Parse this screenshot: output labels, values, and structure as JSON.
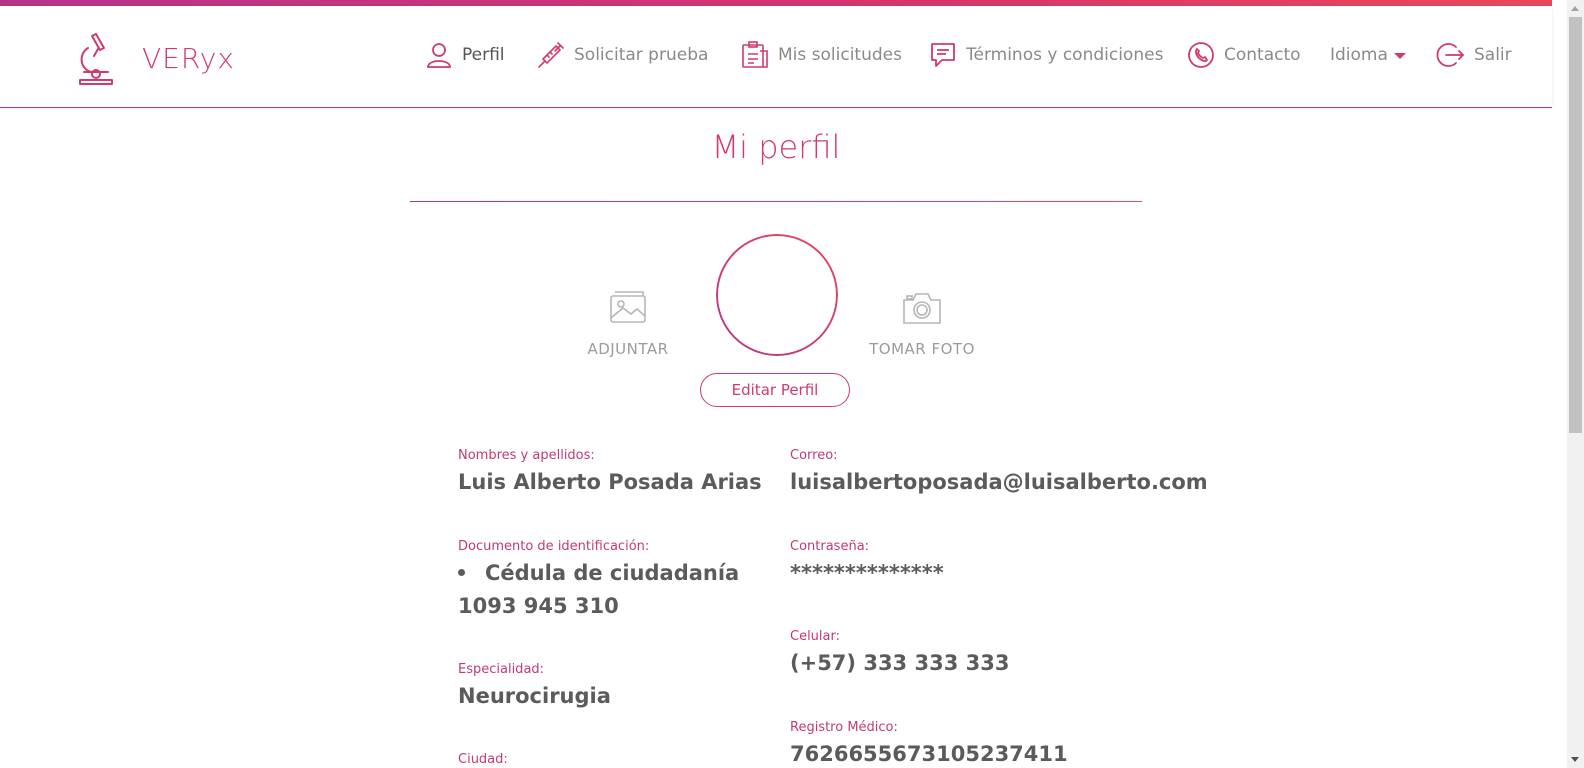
{
  "brand": {
    "name": "VERyx",
    "accent": "#d13a6a",
    "accent_gradient_start": "#b5348a",
    "accent_gradient_end": "#e8485b"
  },
  "nav": {
    "items": [
      {
        "label": "Perfil",
        "icon": "user-icon",
        "active": true
      },
      {
        "label": "Solicitar prueba",
        "icon": "syringe-icon"
      },
      {
        "label": "Mis solicitudes",
        "icon": "clipboard-icon"
      },
      {
        "label": "Términos y condiciones",
        "icon": "message-icon"
      },
      {
        "label": "Contacto",
        "icon": "phone-icon"
      },
      {
        "label": "Idioma",
        "icon": "caret-down-icon"
      },
      {
        "label": "Salir",
        "icon": "logout-icon"
      }
    ]
  },
  "profile": {
    "title": "Mi perfil",
    "attach_label": "ADJUNTAR",
    "take_photo_label": "TOMAR FOTO",
    "edit_label": "Editar Perfil"
  },
  "fields": {
    "name_label": "Nombres y apellidos:",
    "name_value": "Luis Alberto Posada Arias",
    "email_label": "Correo:",
    "email_value": "luisalbertoposada@luisalberto.com",
    "document_label": "Documento de identificación:",
    "document_type": "Cédula de ciudadanía",
    "document_number": "1093 945 310",
    "password_label": "Contraseña:",
    "password_value": "**************",
    "phone_label": "Celular:",
    "phone_value": "(+57) 333 333 333",
    "specialty_label": "Especialidad:",
    "specialty_value": "Neurocirugia",
    "registry_label": "Registro Médico:",
    "registry_value": "762665567310523741​1",
    "city_label": "Ciudad:"
  }
}
